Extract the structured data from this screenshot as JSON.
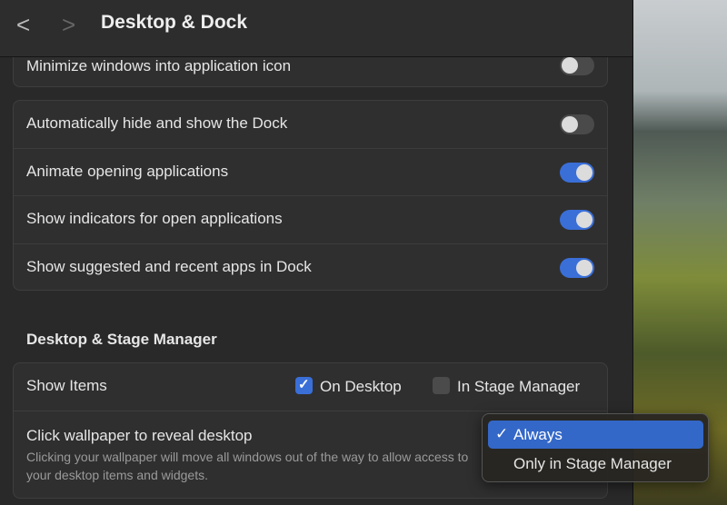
{
  "header": {
    "back": "<",
    "forward": ">",
    "title": "Desktop & Dock"
  },
  "group1": [
    {
      "label": "Minimize windows into application icon",
      "on": false
    }
  ],
  "group2": [
    {
      "label": "Automatically hide and show the Dock",
      "on": false
    },
    {
      "label": "Animate opening applications",
      "on": true
    },
    {
      "label": "Show indicators for open applications",
      "on": true
    },
    {
      "label": "Show suggested and recent apps in Dock",
      "on": true
    }
  ],
  "section": {
    "title": "Desktop & Stage Manager"
  },
  "show_items": {
    "label": "Show Items",
    "on_desktop": "On Desktop",
    "on_desktop_checked": true,
    "in_stage_manager": "In Stage Manager",
    "in_stage_manager_checked": false
  },
  "click_wallpaper": {
    "label": "Click wallpaper to reveal desktop",
    "description": "Clicking your wallpaper will move all windows out of the way to allow access to your desktop items and widgets."
  },
  "menu": {
    "check": "✓",
    "options": [
      "Always",
      "Only in Stage Manager"
    ],
    "selected": "Always"
  }
}
